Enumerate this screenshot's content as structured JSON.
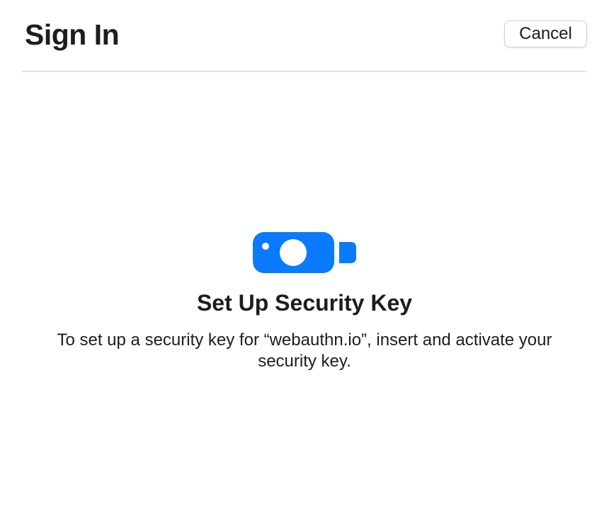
{
  "header": {
    "title": "Sign In",
    "cancel_label": "Cancel"
  },
  "main": {
    "icon": "security-key-icon",
    "heading": "Set Up Security Key",
    "description": "To set up a security key for “webauthn.io”, insert and activate your security key."
  },
  "colors": {
    "accent": "#0a7aff",
    "text": "#1d1d1f",
    "divider": "#e3e3e3"
  }
}
